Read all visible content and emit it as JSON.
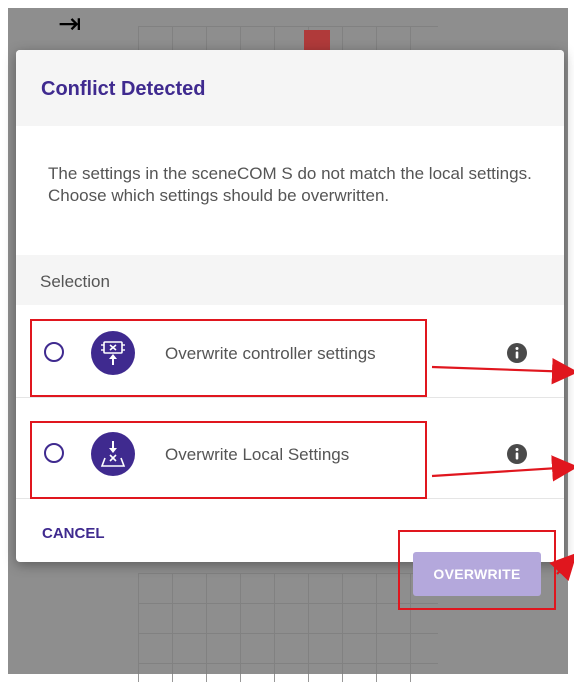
{
  "dialog": {
    "title": "Conflict Detected",
    "message": "The settings in the sceneCOM S do not match the local settings. Choose which settings should be overwritten.",
    "section_label": "Selection",
    "options": [
      {
        "label": "Overwrite controller settings",
        "icon": "upload-to-controller-icon",
        "selected": false
      },
      {
        "label": "Overwrite Local Settings",
        "icon": "download-to-local-icon",
        "selected": false
      }
    ],
    "cancel_label": "CANCEL",
    "overwrite_label": "OVERWRITE",
    "overwrite_enabled": false
  },
  "background": {
    "collapse_icon": "⇥"
  },
  "colors": {
    "accent": "#3f2a8f",
    "disabled_button": "#b4a8dc",
    "annotation": "#e0161e"
  }
}
